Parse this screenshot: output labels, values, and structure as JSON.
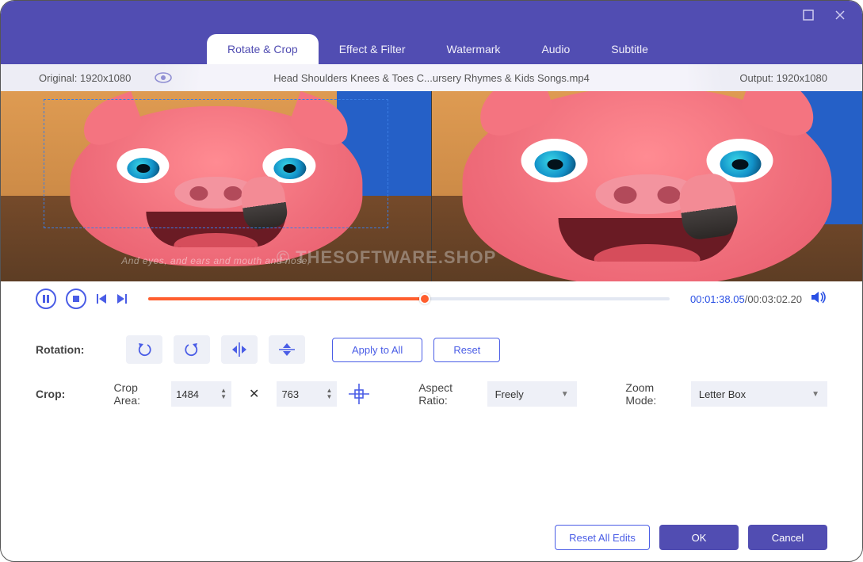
{
  "window": {
    "minimize": "minimize",
    "close": "close"
  },
  "tabs": [
    "Rotate & Crop",
    "Effect & Filter",
    "Watermark",
    "Audio",
    "Subtitle"
  ],
  "active_tab_index": 0,
  "info": {
    "original_label": "Original: 1920x1080",
    "filename": "Head Shoulders Knees & Toes  C...ursery Rhymes & Kids Songs.mp4",
    "output_label": "Output: 1920x1080"
  },
  "preview": {
    "subtitle_text": "And eyes, and ears and mouth and nose,",
    "watermark": "© THESOFTWARE.SHOP"
  },
  "playback": {
    "current_time": "00:01:38.05",
    "total_time": "00:03:02.20",
    "progress_percent": 53
  },
  "rotation": {
    "label": "Rotation:",
    "apply_all": "Apply to All",
    "reset": "Reset"
  },
  "crop": {
    "label": "Crop:",
    "area_label": "Crop Area:",
    "width": "1484",
    "height": "763",
    "aspect_label": "Aspect Ratio:",
    "aspect_value": "Freely",
    "zoom_label": "Zoom Mode:",
    "zoom_value": "Letter Box"
  },
  "footer": {
    "reset_all": "Reset All Edits",
    "ok": "OK",
    "cancel": "Cancel"
  }
}
